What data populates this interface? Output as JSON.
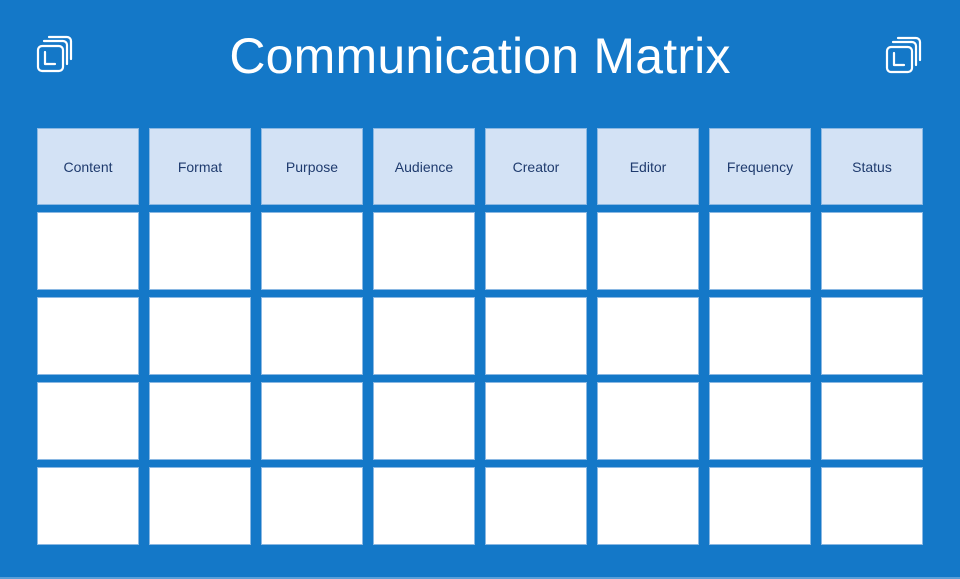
{
  "title": "Communication Matrix",
  "logo_icon": "stacked-layers-logo-icon",
  "colors": {
    "background": "#1478c8",
    "header_cell": "#d3e2f5",
    "header_text": "#1f3b6e",
    "body_cell": "#ffffff"
  },
  "table": {
    "columns": [
      "Content",
      "Format",
      "Purpose",
      "Audience",
      "Creator",
      "Editor",
      "Frequency",
      "Status"
    ],
    "rows": [
      [
        "",
        "",
        "",
        "",
        "",
        "",
        "",
        ""
      ],
      [
        "",
        "",
        "",
        "",
        "",
        "",
        "",
        ""
      ],
      [
        "",
        "",
        "",
        "",
        "",
        "",
        "",
        ""
      ],
      [
        "",
        "",
        "",
        "",
        "",
        "",
        "",
        ""
      ]
    ]
  }
}
